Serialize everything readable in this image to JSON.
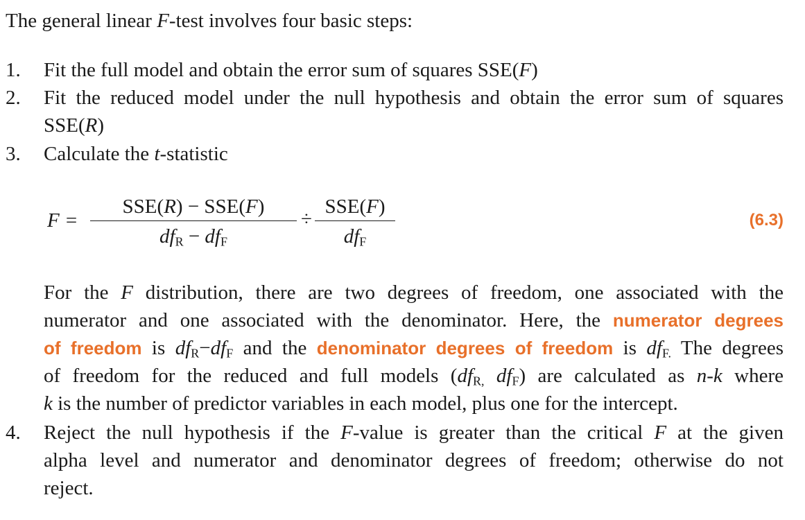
{
  "intro": {
    "pre": "The general linear ",
    "var": "F",
    "post": "-test involves four basic steps:"
  },
  "steps": [
    {
      "number": "1.",
      "pre": "Fit the full model and obtain the error sum of squares SSE(",
      "var": "F",
      "post": ")"
    },
    {
      "number": "2.",
      "line1": "Fit the reduced model under the null hypothesis and obtain the error sum of squares",
      "line2_pre": "SSE(",
      "line2_var": "R",
      "line2_post": ")"
    },
    {
      "number": "3.",
      "pre": "Calculate the ",
      "var": "t",
      "post": "-statistic"
    },
    {
      "number": "4.",
      "line1_pre": "Reject the null hypothesis if the ",
      "line1_var": "F",
      "line1_mid": "-value is greater than the critical ",
      "line1_var2": "F",
      "line1_post": " at the given",
      "line2": "alpha level and numerator and denominator degrees of freedom; otherwise do not",
      "line3": "reject."
    }
  ],
  "equation": {
    "lhs": "F =",
    "num1_pre": "SSE(",
    "num1_var1": "R",
    "num1_mid": ") − SSE(",
    "num1_var2": "F",
    "num1_post": ")",
    "den1_df": "df",
    "den1_sub1": "R",
    "den1_minus": " − ",
    "den1_df2": "df",
    "den1_sub2": "F",
    "operator": "÷",
    "num2_pre": "SSE(",
    "num2_var": "F",
    "num2_post": ")",
    "den2_df": "df",
    "den2_sub": "F",
    "number": "(6.3)"
  },
  "paragraph": {
    "l1_pre": "For the ",
    "l1_var": "F",
    "l1_post": " distribution, there are two degrees of freedom, one associated with the",
    "l2_pre": "numerator and one associated with the denominator. Here, the ",
    "l2_hl": "numerator degrees",
    "l3_hl": "of freedom",
    "l3_a": " is ",
    "l3_df1": "df",
    "l3_sub1": "R",
    "l3_minus": "−",
    "l3_df2": "df",
    "l3_sub2": "F",
    "l3_b": " and the ",
    "l3_hl2": "denominator degrees of freedom",
    "l3_c": " is ",
    "l3_df3": "df",
    "l3_sub3": "F.",
    "l3_d": " The degrees",
    "l4_pre": "of freedom for the reduced and full models (",
    "l4_df1": "df",
    "l4_sub1": "R,",
    "l4_sp": " ",
    "l4_df2": "df",
    "l4_sub2": "F",
    "l4_mid": ") are calculated as ",
    "l4_var": "n-k",
    "l4_post": " where",
    "l5_var": "k",
    "l5_post": " is the number of predictor variables in each model, plus one for the intercept."
  }
}
